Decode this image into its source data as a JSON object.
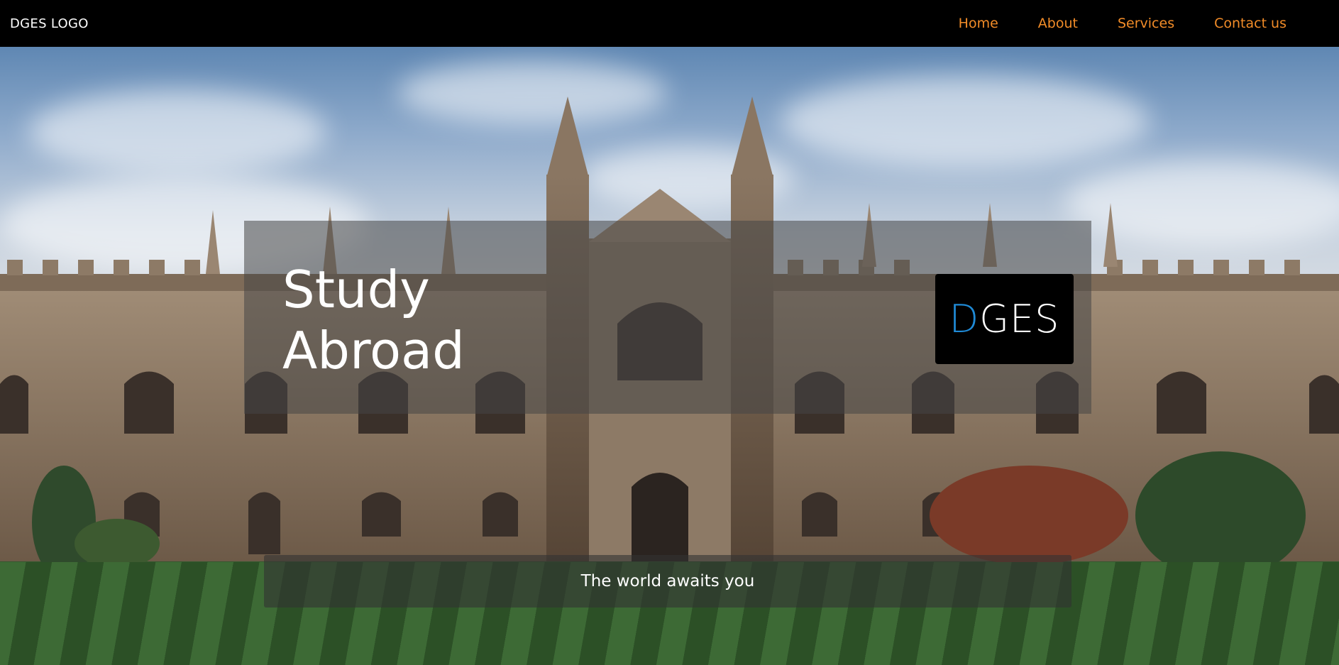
{
  "navbar": {
    "logo": "DGES LOGO",
    "links": [
      {
        "label": "Home"
      },
      {
        "label": "About"
      },
      {
        "label": "Services"
      },
      {
        "label": "Contact us"
      }
    ],
    "link_color": "#f28c28",
    "background": "#000000"
  },
  "hero": {
    "title_line1": "Study",
    "title_line2": "Abroad",
    "brand": {
      "first_letter": "D",
      "rest": "GES",
      "accent_color": "#1f8ad6"
    },
    "tagline": "The world awaits you"
  }
}
